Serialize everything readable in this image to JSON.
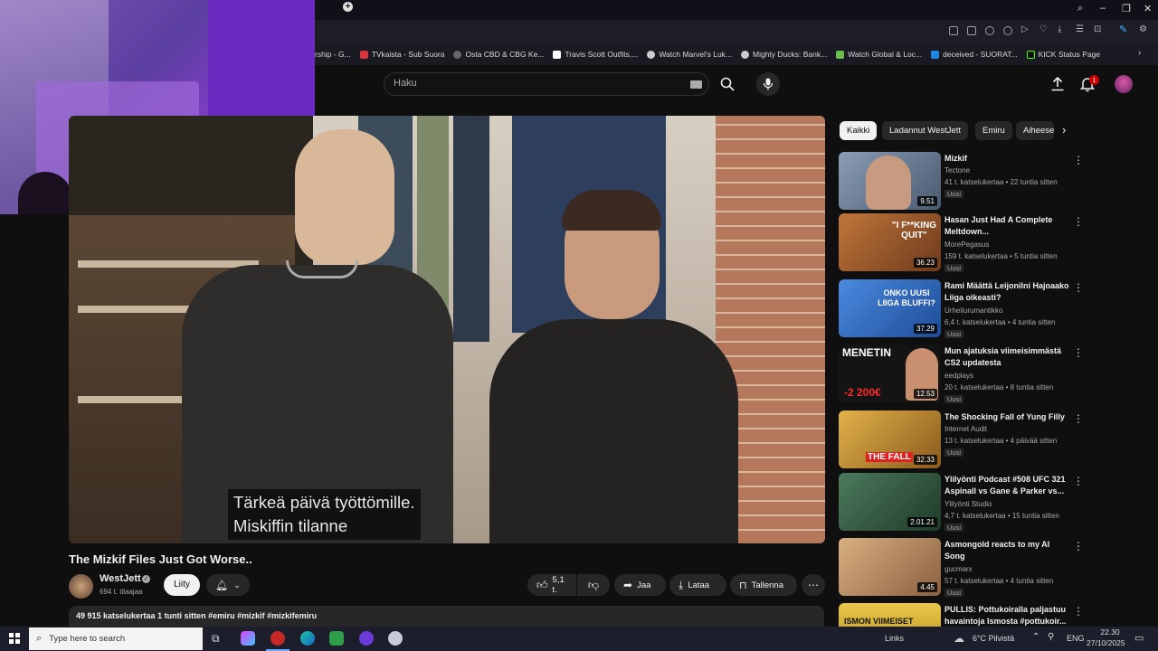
{
  "browser": {
    "new_tab_icon": "plus-icon",
    "bookmarks": [
      {
        "label": "rship - G...",
        "color": "#3a3a44"
      },
      {
        "label": "TVkaista - Sub Suora",
        "color": "#d9363e"
      },
      {
        "label": "Osta CBD & CBG Ke...",
        "color": "#666666"
      },
      {
        "label": "Travis Scott Outfits,...",
        "color": "#ffffff"
      },
      {
        "label": "Watch Marvel's Luk...",
        "color": "#cccccc"
      },
      {
        "label": "Mighty Ducks: Bank...",
        "color": "#cccccc"
      },
      {
        "label": "Watch Global & Loc...",
        "color": "#6abf4b"
      },
      {
        "label": "deceived - SUORAT...",
        "color": "#1e88e5"
      },
      {
        "label": "KICK Status Page",
        "color": "#111111"
      }
    ]
  },
  "header": {
    "search_placeholder": "Haku",
    "notification_count": "1"
  },
  "video": {
    "caption_line1": "Tärkeä päivä työttömille.",
    "caption_line2": "Miskiffin tilanne",
    "title": "The Mizkif Files Just Got Worse..",
    "channel": "WestJett",
    "subscribers": "694 t. tilaajaa",
    "join_label": "Liity",
    "likes": "5,1 t.",
    "share_label": "Jaa",
    "download_label": "Lataa",
    "save_label": "Tallenna",
    "description": "49 915 katselukertaa  1 tunti sitten  #emiru #mizkif #mizkifemiru"
  },
  "sidebar": {
    "chips": [
      "Kaikki",
      "Ladannut WestJett",
      "Emiru",
      "Aiheeseen"
    ],
    "recommendations": [
      {
        "title": "Mizkif",
        "channel": "Tectone",
        "meta": "41 t. katselukertaa • 22 tuntia sitten",
        "badge": "Uusi",
        "duration": "9.51",
        "thumb_color": "#6a7f99"
      },
      {
        "title": "Hasan Just Had A Complete Meltdown...",
        "channel": "MorePegasus",
        "meta": "159 t. katselukertaa • 5 tuntia sitten",
        "badge": "Uusi",
        "duration": "36.23",
        "thumb_color": "#9b6a3c"
      },
      {
        "title": "Rami Määttä Leijonilni Hajoaako Liiga oikeasti?",
        "channel": "Urheilurumantikko",
        "meta": "6,4 t. katselukertaa • 4 tuntia sitten",
        "badge": "Uusi",
        "duration": "37.29",
        "thumb_color": "#3a74c8"
      },
      {
        "title": "Mun ajatuksia viimeisimmästä CS2 updatesta",
        "channel": "eedplays",
        "meta": "20 t. katselukertaa • 8 tuntia sitten",
        "badge": "Uusi",
        "duration": "12.53",
        "thumb_color": "#1a1a1a"
      },
      {
        "title": "The Shocking Fall of Yung Filly",
        "channel": "Internet Audit",
        "meta": "13 t. katselukertaa • 4 päivää sitten",
        "badge": "Uusi",
        "duration": "32.33",
        "thumb_color": "#c9a23c"
      },
      {
        "title": "Ylilyönti Podcast #508 UFC 321 Aspinall vs Gane & Parker vs...",
        "channel": "Ylilyönti Studio",
        "meta": "4,7 t. katselukertaa • 15 tuntia sitten",
        "badge": "Uusi",
        "duration": "2.01.21",
        "thumb_color": "#3b6b4f"
      },
      {
        "title": "Asmongold reacts to my AI Song",
        "channel": "gucmarx",
        "meta": "57 t. katselukertaa • 4 tuntia sitten",
        "badge": "Uusi",
        "duration": "4.45",
        "thumb_color": "#b8894f"
      },
      {
        "title": "PULLIS: Pottukoiralla paljastuu havaintoja Ismosta #pottukoir...",
        "channel": "",
        "meta": "",
        "badge": "",
        "duration": "",
        "thumb_color": "#d0b040"
      }
    ]
  },
  "thumbnail_text": {
    "hasan_text": "\"I F**KING QUIT\"",
    "rami_text": "ONKO UUSI LIIGA BLUFFI?",
    "cs2_text": "MENETIN",
    "cs2_amount": "-2 200€",
    "filly_text": "THE FALL",
    "pullis_text": "ISMON VIIMEISET"
  },
  "taskbar": {
    "search_placeholder": "Type here to search",
    "links_label": "Links",
    "weather": "6°C  Pilvistä",
    "language": "ENG",
    "time": "22.30",
    "date": "27/10/2025"
  }
}
